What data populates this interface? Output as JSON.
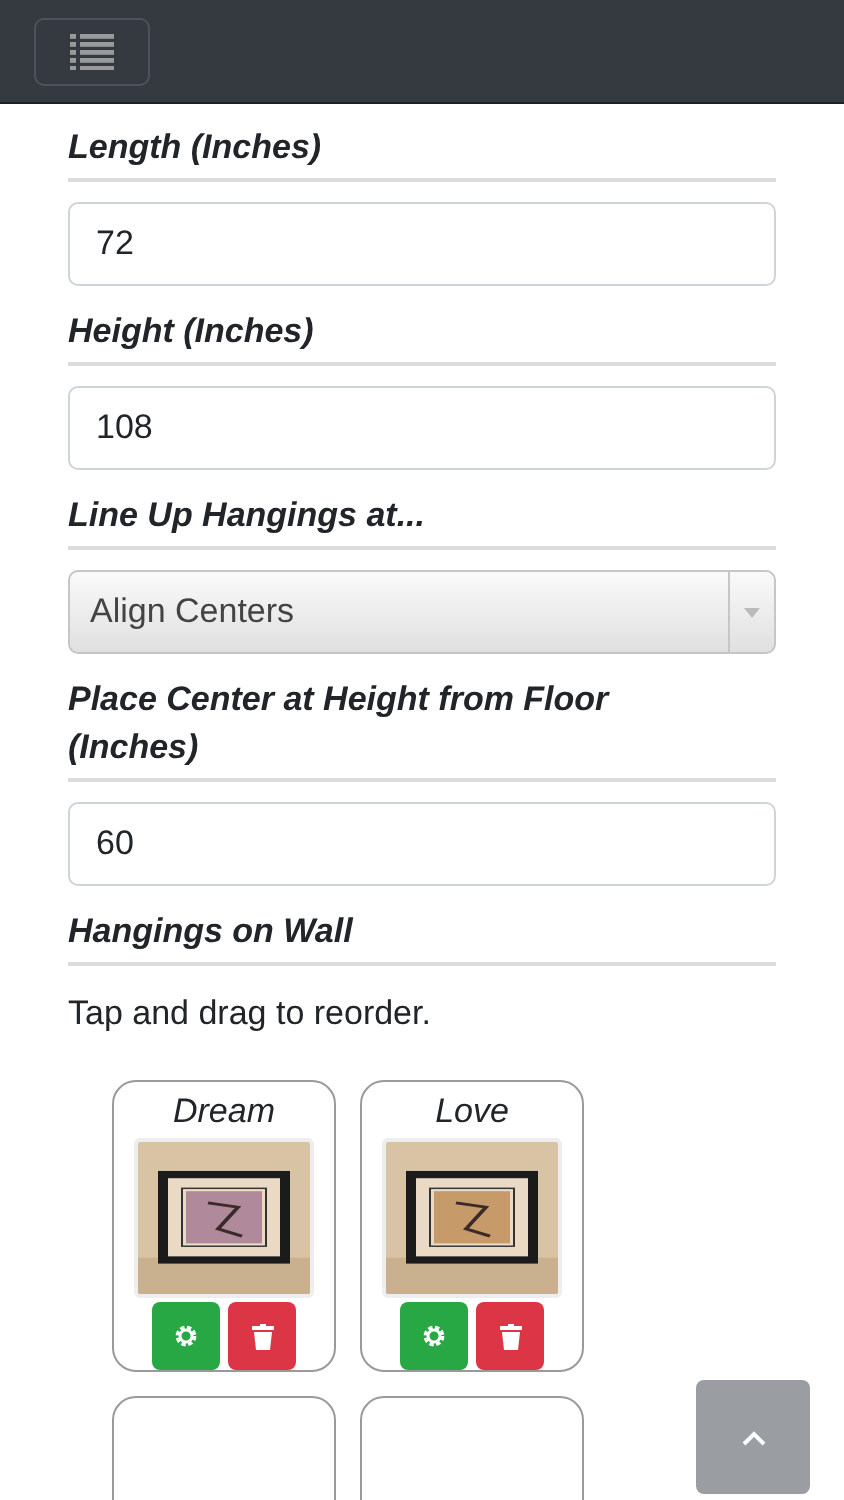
{
  "fields": [
    {
      "kind": "input",
      "label": "Length (Inches)",
      "value": "72"
    },
    {
      "kind": "input",
      "label": "Height (Inches)",
      "value": "108"
    },
    {
      "kind": "select",
      "label": "Line Up Hangings at...",
      "value": "Align Centers"
    },
    {
      "kind": "input",
      "label": "Place Center at Height from Floor (Inches)",
      "value": "60"
    }
  ],
  "hangings": {
    "heading": "Hangings on Wall",
    "hint": "Tap and drag to reorder.",
    "items": [
      {
        "kind": "card",
        "title": "Dream"
      },
      {
        "kind": "card",
        "title": "Love"
      },
      {
        "kind": "partial"
      },
      {
        "kind": "partial"
      }
    ]
  }
}
